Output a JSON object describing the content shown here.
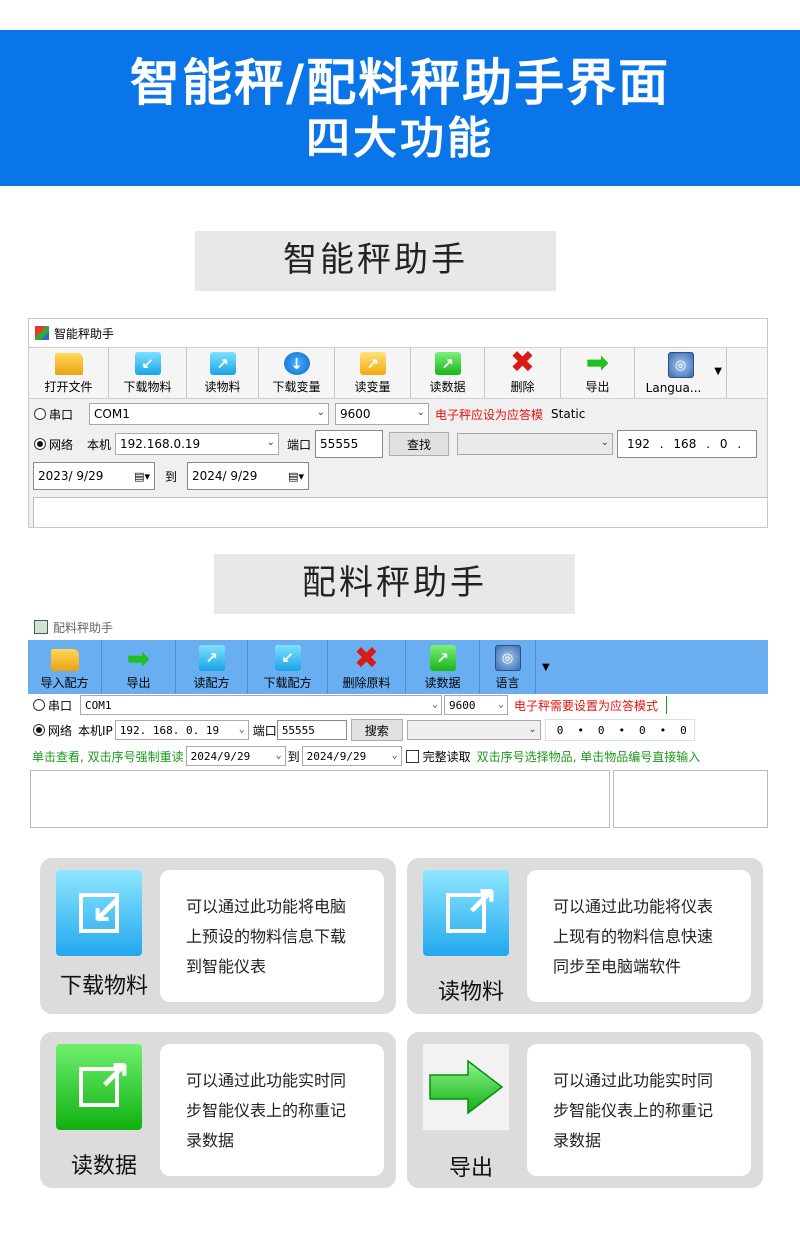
{
  "banner": {
    "line1": "智能秤/配料秤助手界面",
    "line2": "四大功能"
  },
  "section1": {
    "heading": "智能秤助手",
    "window_title": "智能秤助手",
    "toolbar": [
      {
        "label": "打开文件",
        "icon": "folder-open-icon"
      },
      {
        "label": "下载物料",
        "icon": "download-icon"
      },
      {
        "label": "读物料",
        "icon": "read-icon"
      },
      {
        "label": "下载变量",
        "icon": "download-circle-icon"
      },
      {
        "label": "读变量",
        "icon": "read-variable-icon"
      },
      {
        "label": "读数据",
        "icon": "read-data-icon"
      },
      {
        "label": "删除",
        "icon": "delete-x-icon"
      },
      {
        "label": "导出",
        "icon": "export-arrow-icon"
      },
      {
        "label": "Langua...",
        "icon": "globe-icon"
      }
    ],
    "serial_label": "串口",
    "com_value": "COM1",
    "baud_value": "9600",
    "serial_hint": "电子秤应设为应答模",
    "static_text": "Static",
    "network_label": "网络",
    "local_label": "本机",
    "local_ip": "192.168.0.19",
    "port_label": "端口",
    "port_value": "55555",
    "search_button": "查找",
    "remote_ip": [
      "192",
      "168",
      "0",
      ""
    ],
    "date_from": "2023/  9/29",
    "to_label": "到",
    "date_to": "2024/  9/29"
  },
  "section2": {
    "heading": "配料秤助手",
    "window_title": "配料秤助手",
    "toolbar": [
      {
        "label": "导入配方",
        "icon": "folder-open-icon"
      },
      {
        "label": "导出",
        "icon": "export-arrow-icon"
      },
      {
        "label": "读配方",
        "icon": "read-icon"
      },
      {
        "label": "下载配方",
        "icon": "download-icon"
      },
      {
        "label": "删除原料",
        "icon": "delete-x-icon"
      },
      {
        "label": "读数据",
        "icon": "read-data-icon"
      },
      {
        "label": "语言",
        "icon": "globe-icon"
      }
    ],
    "serial_label": "串口",
    "com_value": "COM1",
    "baud_value": "9600",
    "serial_hint": "电子秤需要设置为应答模式",
    "network_label": "网络",
    "local_label": "本机IP",
    "local_ip": "192. 168. 0. 19",
    "port_label": "端口",
    "port_value": "55555",
    "search_button": "搜索",
    "remote_ip": [
      "0",
      "0",
      "0",
      "0"
    ],
    "hint_left": "单击查看, 双击序号强制重读",
    "date_from": "2024/9/29",
    "to_label": "到",
    "date_to": "2024/9/29",
    "full_read_label": "完整读取",
    "hint_right": "双击序号选择物品, 单击物品编号直接输入"
  },
  "features": [
    {
      "caption": "下载物料",
      "icon": "download-icon",
      "desc": [
        "可以通过此功能将电脑",
        "上预设的物料信息下载",
        "到智能仪表"
      ]
    },
    {
      "caption": "读物料",
      "icon": "read-icon",
      "desc": [
        "可以通过此功能将仪表",
        "上现有的物料信息快速",
        "同步至电脑端软件"
      ]
    },
    {
      "caption": "读数据",
      "icon": "read-data-icon",
      "desc": [
        "可以通过此功能实时同",
        "步智能仪表上的称重记",
        "录数据"
      ]
    },
    {
      "caption": "导出",
      "icon": "export-arrow-icon",
      "desc": [
        "可以通过此功能实时同",
        "步智能仪表上的称重记",
        "录数据"
      ]
    }
  ],
  "colors": {
    "banner": "#0a75e8",
    "hint_red": "#e0150f",
    "hint_green": "#1a9a1a",
    "toolbar2_bg": "#6aaef2"
  }
}
